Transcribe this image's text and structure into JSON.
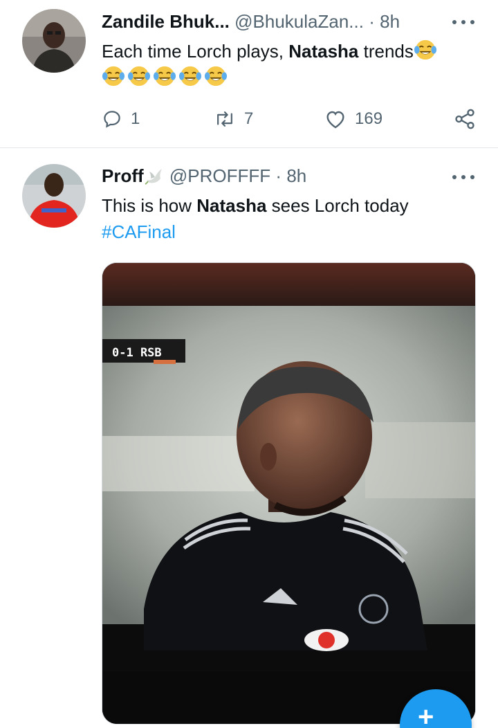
{
  "tweets": [
    {
      "name": "Zandile Bhuk...",
      "handle": "@BhukulaZan...",
      "dot": "·",
      "time": "8h",
      "text_before": "Each time Lorch plays, ",
      "text_bold": "Natasha",
      "text_after": " trends",
      "emoji_count": 6,
      "emoji_name": "face-with-tears-of-joy",
      "replies": "1",
      "retweets": "7",
      "likes": "169"
    },
    {
      "name": "Proff",
      "name_emoji": "dove",
      "handle": "@PROFFFF",
      "dot": "·",
      "time": "8h",
      "text_before": "This is how ",
      "text_bold": "Natasha",
      "text_after": " sees Lorch today",
      "hashtag": "#CAFinal",
      "media": {
        "scoreboard": "0-1 RSB",
        "description": "photo of TV screen"
      }
    }
  ],
  "fab": {
    "icon": "compose-tweet-icon",
    "color": "#1d9bf0"
  },
  "colors": {
    "accent": "#1d9bf0",
    "secondary_text": "#536471",
    "primary_text": "#0f1419"
  }
}
